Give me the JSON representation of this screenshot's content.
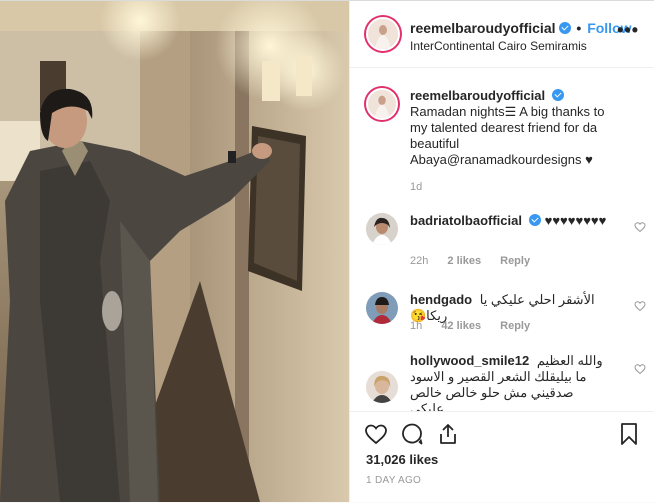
{
  "post": {
    "username": "reemelbaroudyofficial",
    "follow_label": "Follow",
    "separator": "•",
    "location": "InterContinental Cairo Semiramis",
    "more_label": "•••"
  },
  "caption": {
    "username": "reemelbaroudyofficial",
    "text": "Ramadan nights☰ A big thanks to my talented dearest friend for da beautiful Abaya@ranamadkourdesigns ♥",
    "time": "1d"
  },
  "comments": [
    {
      "username": "badriatolbaofficial",
      "text": "♥♥♥♥♥♥♥♥",
      "time": "22h",
      "likes": "2 likes",
      "reply": "Reply"
    },
    {
      "username": "hendgado",
      "text": "الأشقر احلي عليكي يا ريكا😘",
      "time": "1h",
      "likes": "42 likes",
      "reply": "Reply"
    },
    {
      "username": "hollywood_smile12",
      "text": "والله العظيم ما بيليقلك الشعر القصير و الاسود صدقيني مش حلو خالص خالص عليكي",
      "time": "",
      "likes": "",
      "reply": ""
    }
  ],
  "stats": {
    "likes": "31,026 likes",
    "time_ago": "1 DAY AGO"
  },
  "icons": {
    "like": "heart-icon",
    "comment": "comment-icon",
    "share": "share-icon",
    "save": "bookmark-icon",
    "verified": "verified-badge-icon"
  },
  "colors": {
    "link": "#3897f0",
    "text": "#262626",
    "muted": "#999999",
    "border": "#efefef"
  }
}
